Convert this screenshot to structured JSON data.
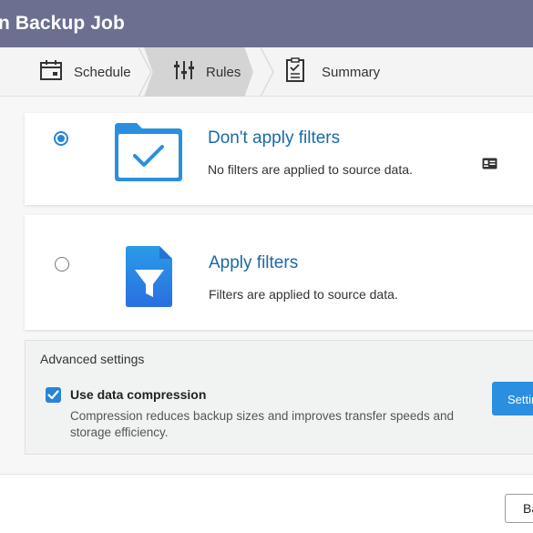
{
  "window": {
    "title": "n Backup Job"
  },
  "steps": [
    {
      "label": "Schedule",
      "icon": "calendar-icon"
    },
    {
      "label": "Rules",
      "icon": "sliders-icon",
      "active": true
    },
    {
      "label": "Summary",
      "icon": "clipboard-icon"
    }
  ],
  "options": [
    {
      "title": "Don't apply filters",
      "description": "No filters are applied to source data.",
      "selected": true,
      "icon": "folder-check-icon"
    },
    {
      "title": "Apply filters",
      "description": "Filters are applied to source data.",
      "selected": false,
      "icon": "file-filter-icon"
    }
  ],
  "advanced": {
    "title": "Advanced settings",
    "compression_label": "Use data compression",
    "compression_checked": true,
    "compression_description": "Compression reduces backup sizes and improves transfer speeds and storage efficiency.",
    "settings_button": "Settings"
  },
  "footer": {
    "back_button": "Back"
  },
  "colors": {
    "titlebar": "#6b7090",
    "accent": "#2a84d6",
    "link_title": "#1a6aa6"
  }
}
